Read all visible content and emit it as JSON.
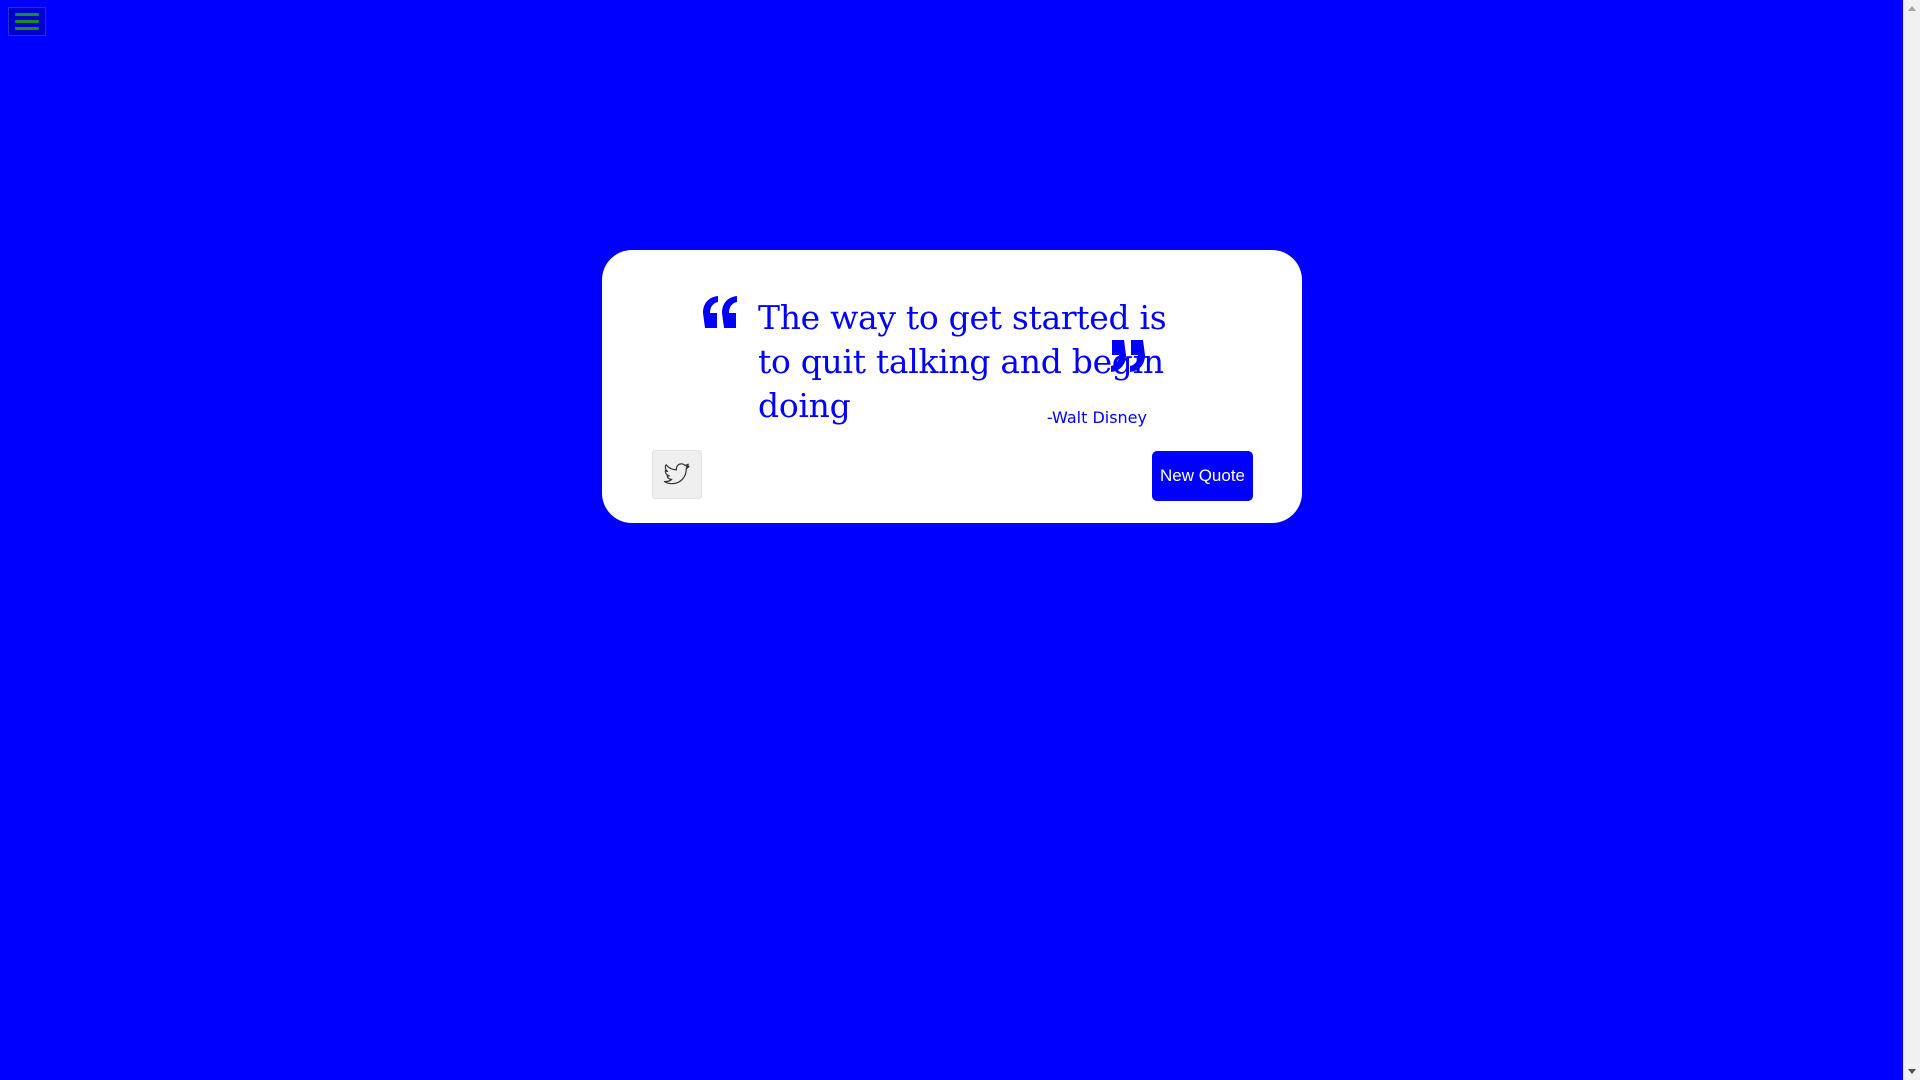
{
  "colors": {
    "background": "#0000ff",
    "card": "#ffffff",
    "accent": "#0000ff",
    "menu_bars": "#1f8a2a"
  },
  "menu": {
    "icon": "hamburger-menu-icon"
  },
  "quote": {
    "text": "The way to get started is to quit talking and begin doing",
    "author": "-Walt Disney",
    "open_icon": "open-quote-icon",
    "close_icon": "close-quote-icon"
  },
  "actions": {
    "tweet_icon": "twitter-bird-icon",
    "new_quote_label": "New Quote"
  }
}
